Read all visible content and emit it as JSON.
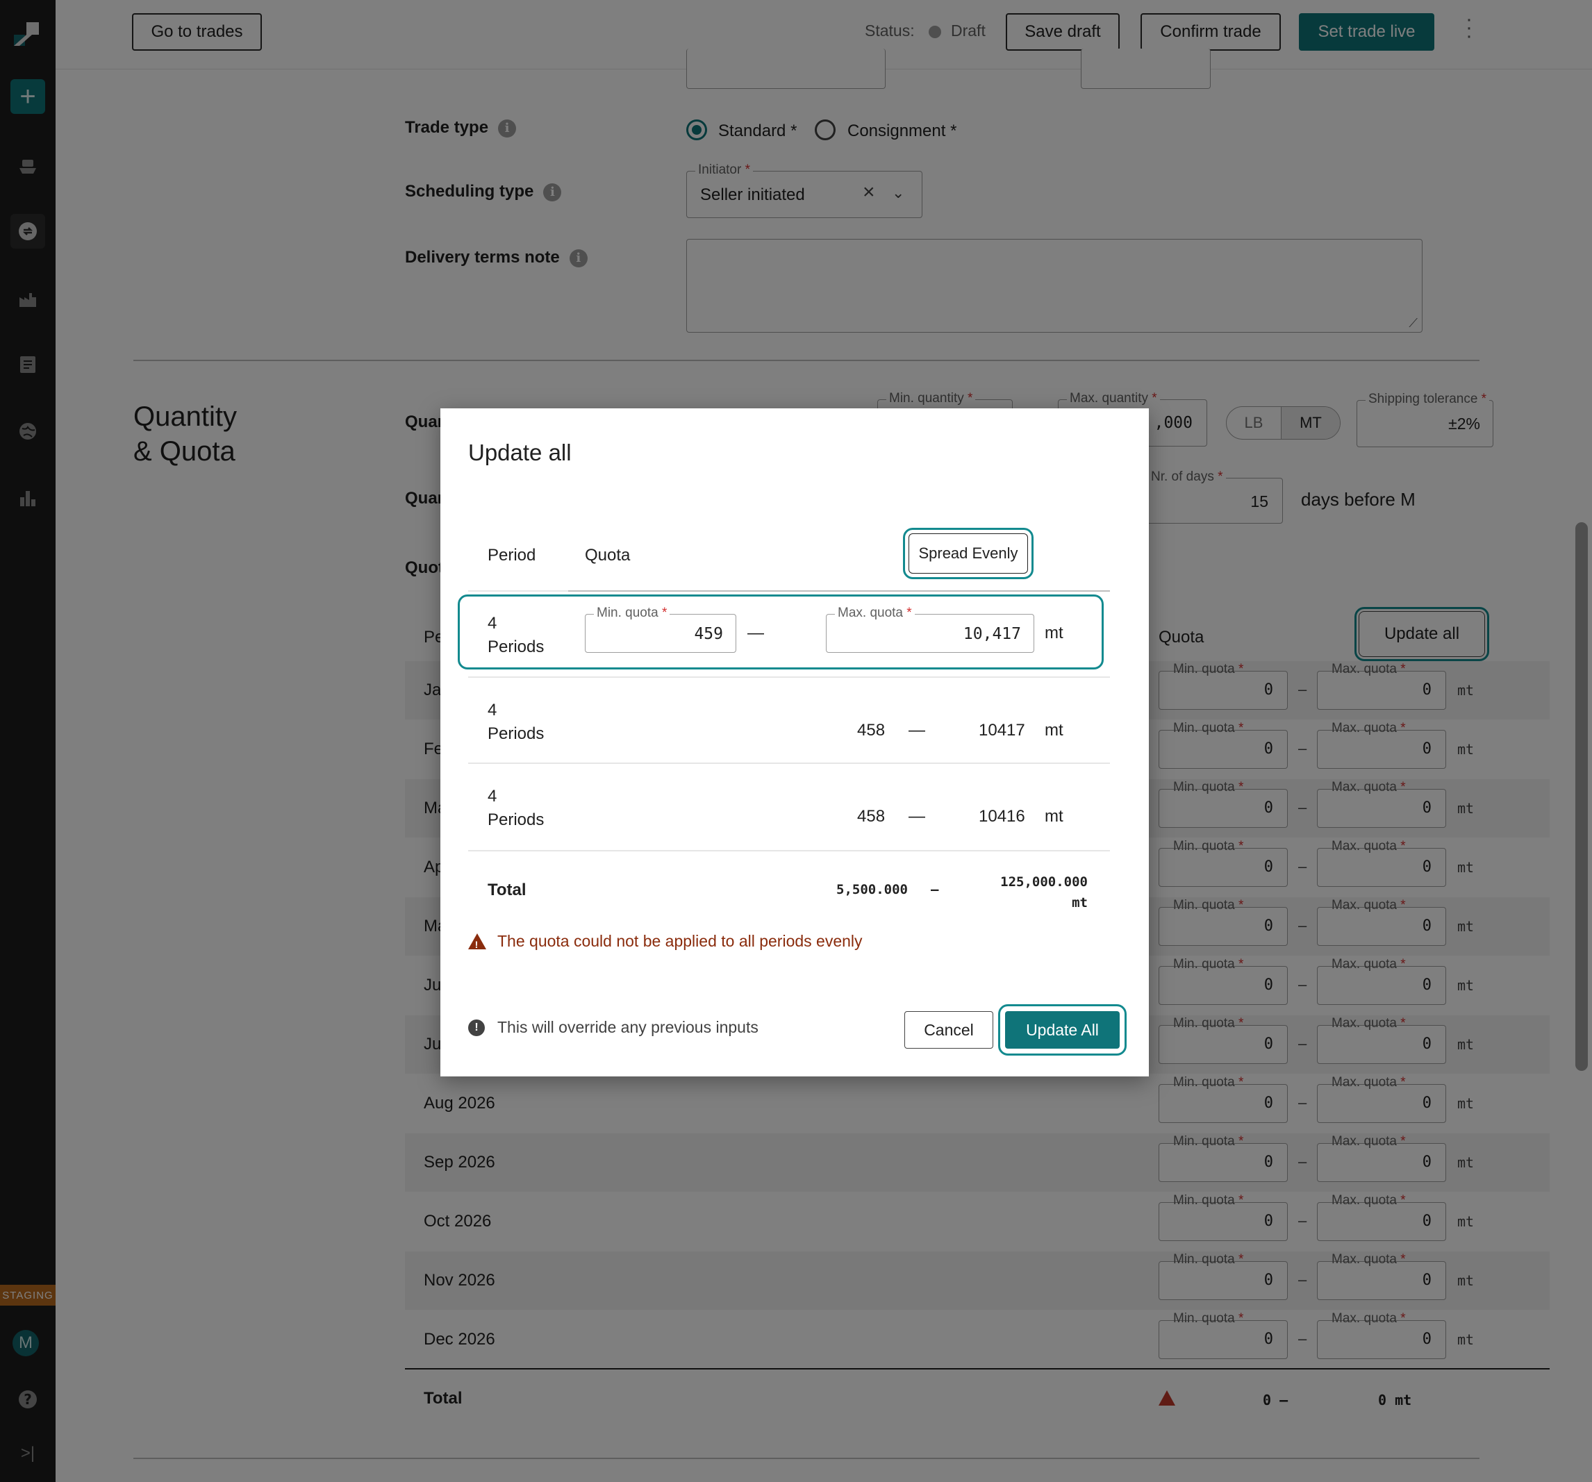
{
  "topbar": {
    "go_to_trades": "Go to trades",
    "status_label": "Status:",
    "status_value": "Draft",
    "save_draft": "Save draft",
    "confirm_trade": "Confirm trade",
    "set_trade_live": "Set trade live"
  },
  "colors": {
    "accent": "#0f7479",
    "warning": "#8a2c0d",
    "sidebar": "#1c1c1c",
    "staging": "#b86a1f"
  },
  "sidebar": {
    "staging": "STAGING",
    "avatar_initial": "M"
  },
  "form": {
    "trade_type": {
      "label": "Trade type",
      "standard": "Standard *",
      "consignment": "Consignment *",
      "selected": "Standard"
    },
    "scheduling_type": {
      "label": "Scheduling type",
      "field_label": "Initiator",
      "value": "Seller initiated"
    },
    "delivery_terms_note": {
      "label": "Delivery terms note",
      "value": ""
    }
  },
  "quantity_section": {
    "title_line1": "Quantity",
    "title_line2": "& Quota",
    "row_label_1": "Quar",
    "row_label_2": "Quar",
    "row_label_3": "Quot",
    "min_quantity_label": "Min. quantity",
    "max_quantity_label": "Max. quantity",
    "max_quantity_value": ",000",
    "unit_lb": "LB",
    "unit_mt": "MT",
    "shipping_tolerance_label": "Shipping tolerance",
    "shipping_tolerance_value": "±2%",
    "nr_of_days_label": "Nr. of days",
    "nr_of_days_value": "15",
    "days_before": "days before M",
    "quota_header": "Quota",
    "period_header_partial": "Pe",
    "update_all_button": "Update all",
    "min_quota_label": "Min. quota",
    "max_quota_label": "Max. quota",
    "unit": "mt",
    "months": [
      "Ja",
      "Fe",
      "Ma",
      "Ap",
      "Ma",
      "Ju",
      "Ju",
      "Aug 2026",
      "Sep 2026",
      "Oct 2026",
      "Nov 2026",
      "Dec 2026"
    ],
    "row_values": {
      "min": "0",
      "max": "0"
    },
    "total_label": "Total",
    "total_min": "0 –",
    "total_max": "0 mt"
  },
  "dialog": {
    "title": "Update all",
    "col_period": "Period",
    "col_quota": "Quota",
    "spread_evenly": "Spread Evenly",
    "edit_row": {
      "period_line1": "4",
      "period_line2": "Periods",
      "min_label": "Min. quota",
      "min_value": "459",
      "max_label": "Max. quota",
      "max_value": "10,417",
      "unit": "mt"
    },
    "rows": [
      {
        "period_line1": "4",
        "period_line2": "Periods",
        "min": "458",
        "dash": "—",
        "max": "10417",
        "unit": "mt"
      },
      {
        "period_line1": "4",
        "period_line2": "Periods",
        "min": "458",
        "dash": "—",
        "max": "10416",
        "unit": "mt"
      }
    ],
    "total_label": "Total",
    "total_min": "5,500.000",
    "total_dash": "–",
    "total_max": "125,000.000",
    "total_unit": "mt",
    "warning": "The quota could not be applied to all periods evenly",
    "override_note": "This will override any previous inputs",
    "cancel": "Cancel",
    "update_all": "Update All"
  }
}
